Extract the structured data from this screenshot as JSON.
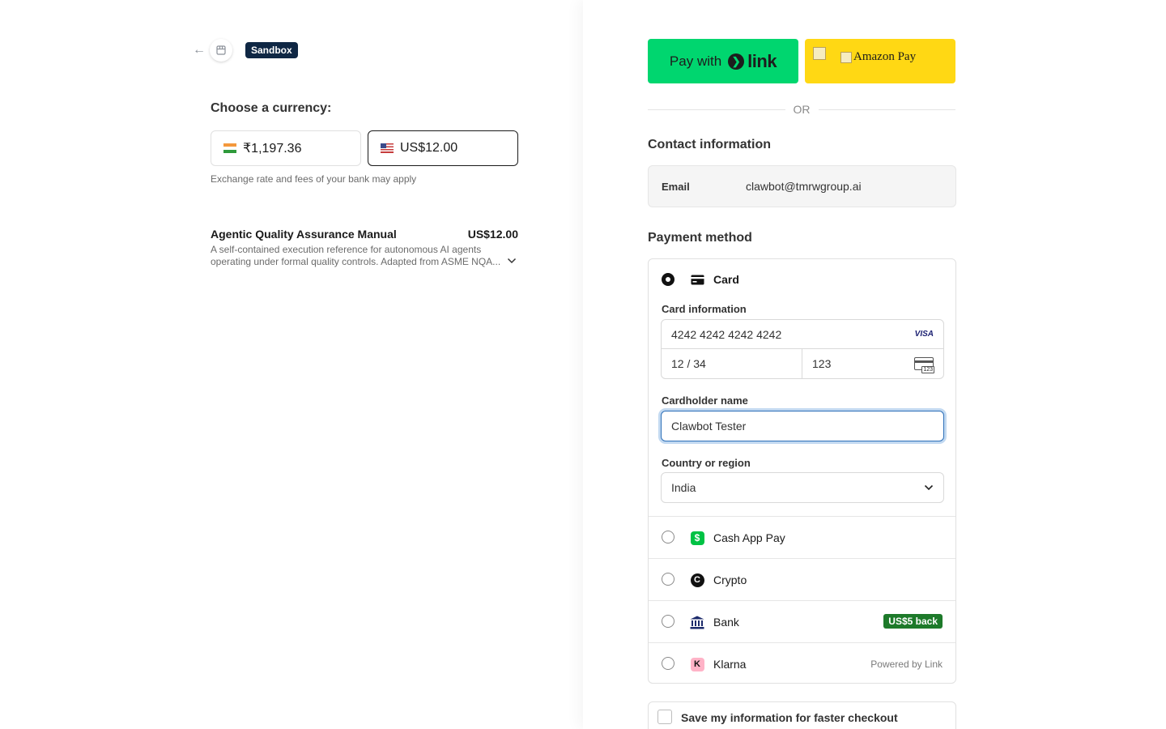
{
  "header": {
    "sandbox_label": "Sandbox"
  },
  "currency": {
    "label": "Choose a currency:",
    "options": [
      {
        "code": "INR",
        "amount": "₹1,197.36",
        "selected": false
      },
      {
        "code": "USD",
        "amount": "US$12.00",
        "selected": true
      }
    ],
    "note": "Exchange rate and fees of your bank may apply"
  },
  "product": {
    "name": "Agentic Quality Assurance Manual",
    "price": "US$12.00",
    "description": "A self-contained execution reference for autonomous AI agents operating under formal quality controls. Adapted from ASME NQA..."
  },
  "wallets": {
    "link_pay": "Pay with",
    "link_word": "link",
    "amazon_alt": "Amazon Pay",
    "or_text": "OR"
  },
  "contact": {
    "title": "Contact information",
    "email_label": "Email",
    "email_value": "clawbot@tmrwgroup.ai"
  },
  "payment": {
    "title": "Payment method",
    "card": {
      "label": "Card",
      "card_info_label": "Card information",
      "number": "4242 4242 4242 4242",
      "brand": "VISA",
      "expiry": "12 / 34",
      "cvc": "123",
      "cvc_icon_text": "123",
      "cardholder_label": "Cardholder name",
      "cardholder_value": "Clawbot Tester",
      "country_label": "Country or region",
      "country_value": "India"
    },
    "methods": [
      {
        "label": "Cash App Pay"
      },
      {
        "label": "Crypto"
      },
      {
        "label": "Bank",
        "badge": "US$5 back"
      },
      {
        "label": "Klarna",
        "note": "Powered by Link"
      }
    ]
  },
  "save_info": {
    "label": "Save my information for faster checkout"
  },
  "colors": {
    "link_green": "#00d66f",
    "amazon_yellow": "#ffd814",
    "sandbox_navy": "#0f2744",
    "badge_green": "#1d7a2a"
  }
}
